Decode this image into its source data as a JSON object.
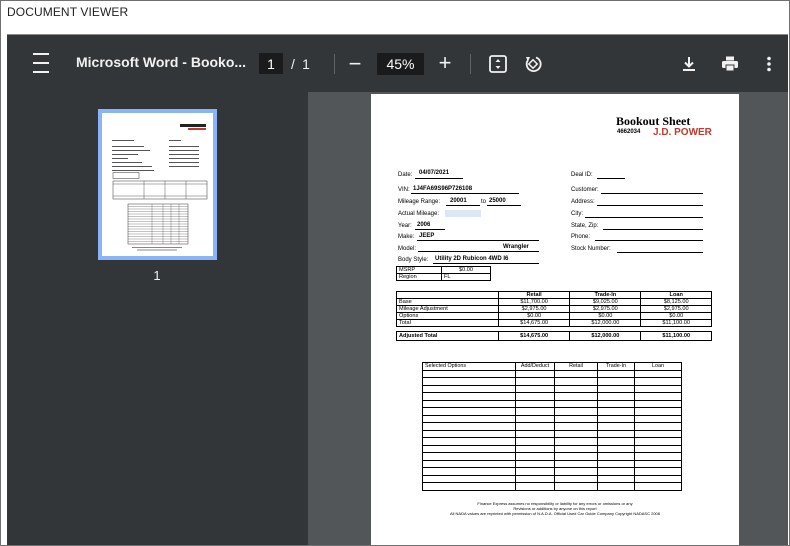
{
  "app": {
    "title": "DOCUMENT VIEWER"
  },
  "toolbar": {
    "doc_title": "Microsoft Word - Booko...",
    "current_page": "1",
    "page_separator": "/",
    "total_pages": "1",
    "zoom": "45%",
    "zoom_out": "−",
    "zoom_in": "+",
    "icons": [
      "menu-icon",
      "fit-page-icon",
      "rotate-icon",
      "download-icon",
      "print-icon",
      "more-vert-icon"
    ]
  },
  "thumbnails": [
    {
      "label": "1"
    }
  ],
  "sheet": {
    "title": "Bookout Sheet",
    "code": "4662034",
    "brand": "J.D. POWER",
    "date_label": "Date:",
    "date_value": "04/07/2021",
    "deal_id_label": "Deal ID:",
    "vin_label": "VIN:",
    "vin_value": "1J4FA69S96P726108",
    "mileage_range_label": "Mileage Range:",
    "mileage_from": "20001",
    "mileage_to_label": "to",
    "mileage_to": "25000",
    "actual_mileage_label": "Actual Mileage:",
    "year_label": "Year:",
    "year_value": "2006",
    "make_label": "Make:",
    "make_value": "JEEP",
    "model_label": "Model:",
    "model_value": "Wrangler",
    "body_style_label": "Body Style:",
    "body_style_value": "Utility 2D Rubicon 4WD I6",
    "customer_label": "Customer:",
    "address_label": "Address:",
    "city_label": "City:",
    "state_zip_label": "State, Zip:",
    "phone_label": "Phone:",
    "stock_label": "Stock Number:",
    "msrp_label": "MSRP",
    "msrp_value": "$0.00",
    "region_label": "Region",
    "region_value": "FL",
    "values_table": {
      "headers": [
        "",
        "Retail",
        "Trade-In",
        "Loan"
      ],
      "rows": [
        [
          "Base",
          "$11,700.00",
          "$9,025.00",
          "$8,125.00"
        ],
        [
          "Mileage Adjustment",
          "$2,975.00",
          "$2,975.00",
          "$2,975.00"
        ],
        [
          "Options",
          "$0.00",
          "$0.00",
          "$0.00"
        ],
        [
          "Total",
          "$14,675.00",
          "$12,000.00",
          "$11,100.00"
        ]
      ],
      "adjusted": [
        "Adjusted Total",
        "$14,675.00",
        "$12,000.00",
        "$11,100.00"
      ]
    },
    "options_table": {
      "headers": [
        "Selected Options",
        "Add/Deduct",
        "Retail",
        "Trade-In",
        "Loan"
      ],
      "empty_rows": 16
    },
    "footer": [
      "Finance Express assumes no responsibility or liability for any errors or omissions or any",
      "Revisions or additions by anyone on this report",
      "All NADA values are reprinted with permission of N.A.D.A. Official Used Car Guide Company Copyright NADASC 2008"
    ]
  }
}
